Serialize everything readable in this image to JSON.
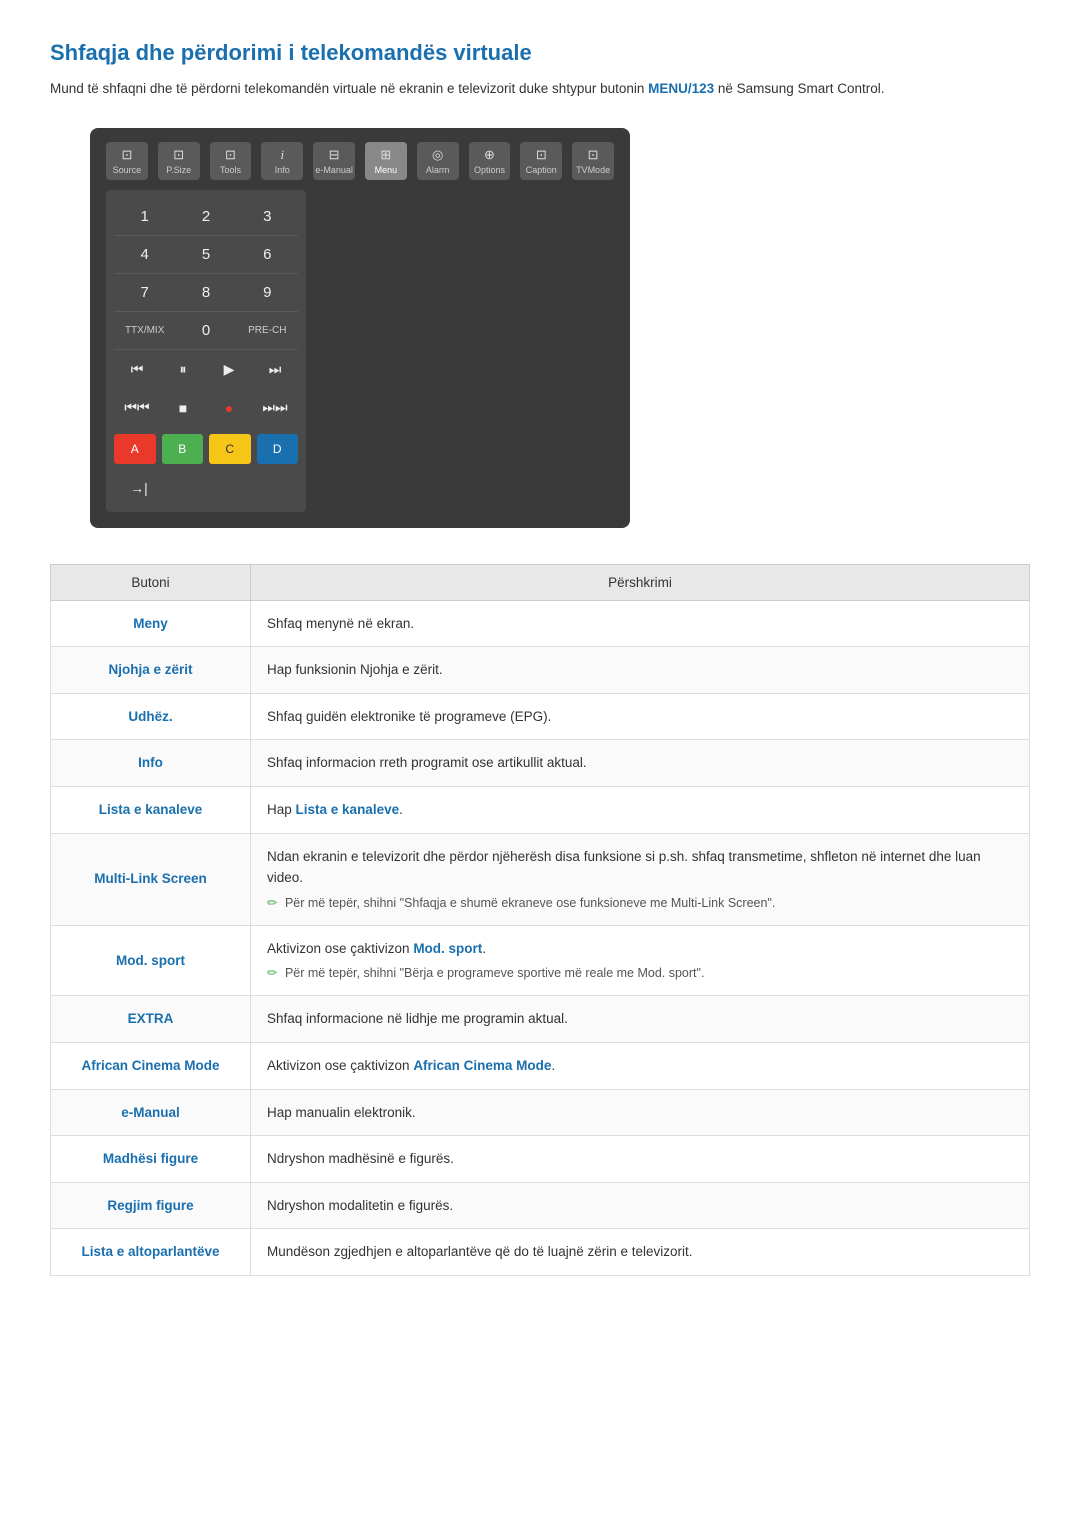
{
  "page": {
    "title": "Shfaqja dhe përdorimi i telekomandës virtuale",
    "intro": "Mund të shfaqni dhe të përdorni telekomandën virtuale në ekranin e televizorit duke shtypur butonin ",
    "intro_highlight": "MENU/123",
    "intro_suffix": " në Samsung Smart Control."
  },
  "remote": {
    "top_buttons": [
      {
        "symbol": "⊡",
        "label": "Source"
      },
      {
        "symbol": "⊡",
        "label": "P.Size"
      },
      {
        "symbol": "⊡",
        "label": "Tools"
      },
      {
        "symbol": "i",
        "label": "Info"
      },
      {
        "symbol": "⊡",
        "label": "e-Manual"
      },
      {
        "symbol": "⊞",
        "label": "Menu",
        "active": true
      },
      {
        "symbol": "◎",
        "label": "Alarm"
      },
      {
        "symbol": "⊕",
        "label": "Options"
      },
      {
        "symbol": "⊡",
        "label": "Caption"
      },
      {
        "symbol": "⊡",
        "label": "TVMode"
      }
    ],
    "numpad": [
      [
        "1",
        "2",
        "3"
      ],
      [
        "4",
        "5",
        "6"
      ],
      [
        "7",
        "8",
        "9"
      ],
      [
        "TTX/MIX",
        "0",
        "PRE-CH"
      ]
    ],
    "transport1": [
      "⏮",
      "⏸",
      "▶",
      "⏭"
    ],
    "transport2": [
      "⏮⏮",
      "■",
      "●",
      "⏭⏭"
    ],
    "color_buttons": [
      {
        "label": "A",
        "color": "red"
      },
      {
        "label": "B",
        "color": "green"
      },
      {
        "label": "C",
        "color": "yellow"
      },
      {
        "label": "D",
        "color": "blue"
      }
    ],
    "arrow_button": "→|"
  },
  "table": {
    "col_button": "Butoni",
    "col_description": "Përshkrimi",
    "rows": [
      {
        "button": "Meny",
        "description": "Shfaq menynë në ekran.",
        "note": ""
      },
      {
        "button": "Njohja e zërit",
        "description": "Hap funksionin Njohja e zërit.",
        "note": ""
      },
      {
        "button": "Udhëz.",
        "description": "Shfaq guidën elektronike të programeve (EPG).",
        "note": ""
      },
      {
        "button": "Info",
        "description": "Shfaq informacion rreth programit ose artikullit aktual.",
        "note": ""
      },
      {
        "button": "Lista e kanaleve",
        "description": "Hap ",
        "description_link": "Lista e kanaleve",
        "description_suffix": ".",
        "note": ""
      },
      {
        "button": "Multi-Link Screen",
        "description": "Ndan ekranin e televizorit dhe përdor njëherësh disa funksione si p.sh. shfaq transmetime, shfleton në internet dhe luan video.",
        "note": "Për më tepër, shihni \"Shfaqja e shumë ekraneve ose funksioneve me Multi-Link Screen\"."
      },
      {
        "button": "Mod. sport",
        "description": "Aktivizon ose çaktivizon ",
        "description_link": "Mod. sport",
        "description_suffix": ".",
        "note": "Për më tepër, shihni \"Bërja e programeve sportive më reale me Mod. sport\"."
      },
      {
        "button": "EXTRA",
        "description": "Shfaq informacione në lidhje me programin aktual.",
        "note": ""
      },
      {
        "button": "African Cinema Mode",
        "description": "Aktivizon ose çaktivizon ",
        "description_link": "African Cinema Mode",
        "description_suffix": ".",
        "note": ""
      },
      {
        "button": "e-Manual",
        "description": "Hap manualin elektronik.",
        "note": ""
      },
      {
        "button": "Madhësi figure",
        "description": "Ndryshon madhësinë e figurës.",
        "note": ""
      },
      {
        "button": "Regjim figure",
        "description": "Ndryshon modalitetin e figurës.",
        "note": ""
      },
      {
        "button": "Lista e altoparlantëve",
        "description": "Mundëson zgjedhjen e altoparlantëve që do të luajnë zërin e televizorit.",
        "note": ""
      }
    ]
  }
}
